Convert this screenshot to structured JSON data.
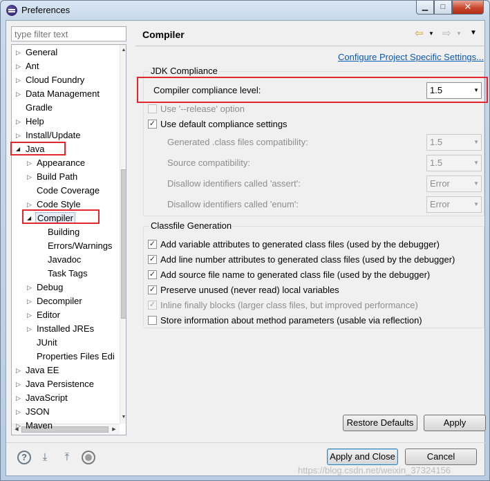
{
  "window": {
    "title": "Preferences"
  },
  "filter": {
    "placeholder": "type filter text"
  },
  "tree": {
    "items": [
      {
        "label": "General",
        "level": 0,
        "expand": "collapsed"
      },
      {
        "label": "Ant",
        "level": 0,
        "expand": "collapsed"
      },
      {
        "label": "Cloud Foundry",
        "level": 0,
        "expand": "collapsed"
      },
      {
        "label": "Data Management",
        "level": 0,
        "expand": "collapsed"
      },
      {
        "label": "Gradle",
        "level": 0,
        "expand": "none"
      },
      {
        "label": "Help",
        "level": 0,
        "expand": "collapsed"
      },
      {
        "label": "Install/Update",
        "level": 0,
        "expand": "collapsed"
      },
      {
        "label": "Java",
        "level": 0,
        "expand": "expanded"
      },
      {
        "label": "Appearance",
        "level": 1,
        "expand": "collapsed"
      },
      {
        "label": "Build Path",
        "level": 1,
        "expand": "collapsed"
      },
      {
        "label": "Code Coverage",
        "level": 1,
        "expand": "none"
      },
      {
        "label": "Code Style",
        "level": 1,
        "expand": "collapsed"
      },
      {
        "label": "Compiler",
        "level": 1,
        "expand": "expanded",
        "selected": true
      },
      {
        "label": "Building",
        "level": 2,
        "expand": "none"
      },
      {
        "label": "Errors/Warnings",
        "level": 2,
        "expand": "none"
      },
      {
        "label": "Javadoc",
        "level": 2,
        "expand": "none"
      },
      {
        "label": "Task Tags",
        "level": 2,
        "expand": "none"
      },
      {
        "label": "Debug",
        "level": 1,
        "expand": "collapsed"
      },
      {
        "label": "Decompiler",
        "level": 1,
        "expand": "collapsed"
      },
      {
        "label": "Editor",
        "level": 1,
        "expand": "collapsed"
      },
      {
        "label": "Installed JREs",
        "level": 1,
        "expand": "collapsed"
      },
      {
        "label": "JUnit",
        "level": 1,
        "expand": "none"
      },
      {
        "label": "Properties Files Edi",
        "level": 1,
        "expand": "none"
      },
      {
        "label": "Java EE",
        "level": 0,
        "expand": "collapsed"
      },
      {
        "label": "Java Persistence",
        "level": 0,
        "expand": "collapsed"
      },
      {
        "label": "JavaScript",
        "level": 0,
        "expand": "collapsed"
      },
      {
        "label": "JSON",
        "level": 0,
        "expand": "collapsed"
      },
      {
        "label": "Maven",
        "level": 0,
        "expand": "collapsed"
      }
    ]
  },
  "page": {
    "title": "Compiler",
    "configure_link": "Configure Project Specific Settings...",
    "jdk_group": {
      "title": "JDK Compliance",
      "compliance_label": "Compiler compliance level:",
      "compliance_value": "1.5",
      "release_option": {
        "label": "Use '--release' option",
        "checked": false,
        "enabled": false
      },
      "default_settings": {
        "label": "Use default compliance settings",
        "checked": true,
        "enabled": true
      },
      "generated_compat": {
        "label": "Generated .class files compatibility:",
        "value": "1.5"
      },
      "source_compat": {
        "label": "Source compatibility:",
        "value": "1.5"
      },
      "disallow_assert": {
        "label": "Disallow identifiers called 'assert':",
        "value": "Error"
      },
      "disallow_enum": {
        "label": "Disallow identifiers called 'enum':",
        "value": "Error"
      }
    },
    "classfile_group": {
      "title": "Classfile Generation",
      "options": [
        {
          "label": "Add variable attributes to generated class files (used by the debugger)",
          "checked": true,
          "enabled": true
        },
        {
          "label": "Add line number attributes to generated class files (used by the debugger)",
          "checked": true,
          "enabled": true
        },
        {
          "label": "Add source file name to generated class file (used by the debugger)",
          "checked": true,
          "enabled": true
        },
        {
          "label": "Preserve unused (never read) local variables",
          "checked": true,
          "enabled": true
        },
        {
          "label": "Inline finally blocks (larger class files, but improved performance)",
          "checked": true,
          "enabled": false
        },
        {
          "label": "Store information about method parameters (usable via reflection)",
          "checked": false,
          "enabled": true
        }
      ]
    },
    "restore_defaults": "Restore Defaults",
    "apply": "Apply"
  },
  "footer": {
    "apply_and_close": "Apply and Close",
    "cancel": "Cancel",
    "icons": [
      "help-icon",
      "import-icon",
      "export-icon",
      "record-icon"
    ]
  },
  "watermark": "https://blog.csdn.net/weixin_37324156"
}
